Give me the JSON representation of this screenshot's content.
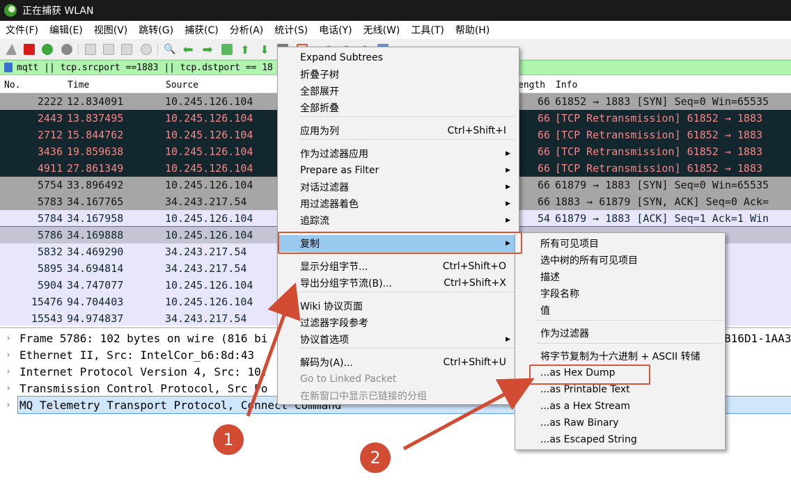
{
  "window": {
    "title": "正在捕获 WLAN"
  },
  "menubar": [
    "文件(F)",
    "编辑(E)",
    "视图(V)",
    "跳转(G)",
    "捕获(C)",
    "分析(A)",
    "统计(S)",
    "电话(Y)",
    "无线(W)",
    "工具(T)",
    "帮助(H)"
  ],
  "toolbar": {
    "icons": [
      "shark-fin-start-icon",
      "stop-capture-icon",
      "restart-capture-icon",
      "capture-options-icon",
      "open-file-icon",
      "save-file-icon",
      "close-file-icon",
      "reload-file-icon",
      "find-packet-icon",
      "go-back-icon",
      "go-forward-icon",
      "go-to-packet-icon",
      "go-first-icon",
      "go-last-icon",
      "autoscroll-icon",
      "colorize-icon",
      "zoom-in-icon",
      "zoom-out-icon",
      "zoom-normal-icon",
      "resize-columns-icon"
    ]
  },
  "filter": {
    "text": "mqtt || tcp.srcport ==1883 || tcp.dstport == 18"
  },
  "packet_list": {
    "columns": {
      "no": "No.",
      "time": "Time",
      "source": "Source",
      "length": "ength",
      "info": "Info"
    },
    "rows": [
      {
        "no": "2222",
        "time": "12.834091",
        "source": "10.245.126.104",
        "length": "66",
        "info": "61852 → 1883 [SYN] Seq=0 Win=65535",
        "style": "gray"
      },
      {
        "no": "2443",
        "time": "13.837495",
        "source": "10.245.126.104",
        "length": "66",
        "info": "[TCP Retransmission] 61852 → 1883",
        "style": "dark"
      },
      {
        "no": "2712",
        "time": "15.844762",
        "source": "10.245.126.104",
        "length": "66",
        "info": "[TCP Retransmission] 61852 → 1883",
        "style": "dark"
      },
      {
        "no": "3436",
        "time": "19.859638",
        "source": "10.245.126.104",
        "length": "66",
        "info": "[TCP Retransmission] 61852 → 1883",
        "style": "dark"
      },
      {
        "no": "4911",
        "time": "27.861349",
        "source": "10.245.126.104",
        "length": "66",
        "info": "[TCP Retransmission] 61852 → 1883",
        "style": "dark"
      },
      {
        "no": "5754",
        "time": "33.896492",
        "source": "10.245.126.104",
        "length": "66",
        "info": "61879 → 1883 [SYN] Seq=0 Win=65535",
        "style": "gray"
      },
      {
        "no": "5783",
        "time": "34.167765",
        "source": "34.243.217.54",
        "length": "66",
        "info": "1883 → 61879 [SYN, ACK] Seq=0 Ack=",
        "style": "gray"
      },
      {
        "no": "5784",
        "time": "34.167958",
        "source": "10.245.126.104",
        "length": "54",
        "info": "61879 → 1883 [ACK] Seq=1 Ack=1 Win",
        "style": "lav"
      },
      {
        "no": "5786",
        "time": "34.169888",
        "source": "10.245.126.104",
        "length": "",
        "info": "",
        "style": "sel"
      },
      {
        "no": "5832",
        "time": "34.469290",
        "source": "34.243.217.54",
        "length": "",
        "info": "Ack=49 Wi",
        "style": "lav"
      },
      {
        "no": "5895",
        "time": "34.694814",
        "source": "34.243.217.54",
        "length": "",
        "info": "",
        "style": "lav"
      },
      {
        "no": "5904",
        "time": "34.747077",
        "source": "10.245.126.104",
        "length": "",
        "info": "0 Ack=5 Wi",
        "style": "lav"
      },
      {
        "no": "15476",
        "time": "94.704403",
        "source": "10.245.126.104",
        "length": "",
        "info": "",
        "style": "lav"
      },
      {
        "no": "15543",
        "time": "94.974837",
        "source": "34.243.217.54",
        "length": "",
        "info": "Ack=51 Wi",
        "style": "lav"
      }
    ]
  },
  "details": [
    {
      "text": "Frame 5786: 102 bytes on wire (816 bi",
      "tail": "B16D1-1AA3",
      "selected": false
    },
    {
      "text": "Ethernet II, Src: IntelCor_b6:8d:43",
      "tail": "",
      "selected": false
    },
    {
      "text": "Internet Protocol Version 4, Src: 10.",
      "tail": "",
      "selected": false
    },
    {
      "text": "Transmission Control Protocol, Src Po",
      "tail": "",
      "selected": false
    },
    {
      "text": "MQ Telemetry Transport Protocol, Connect Command",
      "tail": "",
      "selected": true
    }
  ],
  "context_menu": {
    "items": [
      {
        "label": "Expand Subtrees",
        "shortcut": "",
        "submenu": false,
        "disabled": false
      },
      {
        "label": "折叠子树",
        "shortcut": "",
        "submenu": false,
        "disabled": false
      },
      {
        "label": "全部展开",
        "shortcut": "",
        "submenu": false,
        "disabled": false
      },
      {
        "label": "全部折叠",
        "shortcut": "",
        "submenu": false,
        "disabled": false
      },
      {
        "label": "应用为列",
        "shortcut": "Ctrl+Shift+I",
        "submenu": false,
        "disabled": false
      },
      {
        "label": "作为过滤器应用",
        "shortcut": "",
        "submenu": true,
        "disabled": false
      },
      {
        "label": "Prepare as Filter",
        "shortcut": "",
        "submenu": true,
        "disabled": false
      },
      {
        "label": "对话过滤器",
        "shortcut": "",
        "submenu": true,
        "disabled": false
      },
      {
        "label": "用过滤器着色",
        "shortcut": "",
        "submenu": true,
        "disabled": false
      },
      {
        "label": "追踪流",
        "shortcut": "",
        "submenu": true,
        "disabled": false
      },
      {
        "label": "复制",
        "shortcut": "",
        "submenu": true,
        "disabled": false
      },
      {
        "label": "显示分组字节...",
        "shortcut": "Ctrl+Shift+O",
        "submenu": false,
        "disabled": false
      },
      {
        "label": "导出分组字节流(B)...",
        "shortcut": "Ctrl+Shift+X",
        "submenu": false,
        "disabled": false
      },
      {
        "label": "Wiki 协议页面",
        "shortcut": "",
        "submenu": false,
        "disabled": false
      },
      {
        "label": "过滤器字段参考",
        "shortcut": "",
        "submenu": false,
        "disabled": false
      },
      {
        "label": "协议首选项",
        "shortcut": "",
        "submenu": true,
        "disabled": false
      },
      {
        "label": "解码为(A)...",
        "shortcut": "Ctrl+Shift+U",
        "submenu": false,
        "disabled": false
      },
      {
        "label": "Go to Linked Packet",
        "shortcut": "",
        "submenu": false,
        "disabled": true
      },
      {
        "label": "在新窗口中显示已链接的分组",
        "shortcut": "",
        "submenu": false,
        "disabled": true
      }
    ]
  },
  "copy_submenu": {
    "items": [
      "所有可见项目",
      "选中树的所有可见项目",
      "描述",
      "字段名称",
      "值",
      "作为过滤器",
      "将字节复制为十六进制 + ASCII 转储",
      "...as Hex Dump",
      "...as Printable Text",
      "...as a Hex Stream",
      "...as Raw Binary",
      "...as Escaped String"
    ]
  },
  "annotations": {
    "badge1": "1",
    "badge2": "2",
    "accent": "#d24b33"
  }
}
